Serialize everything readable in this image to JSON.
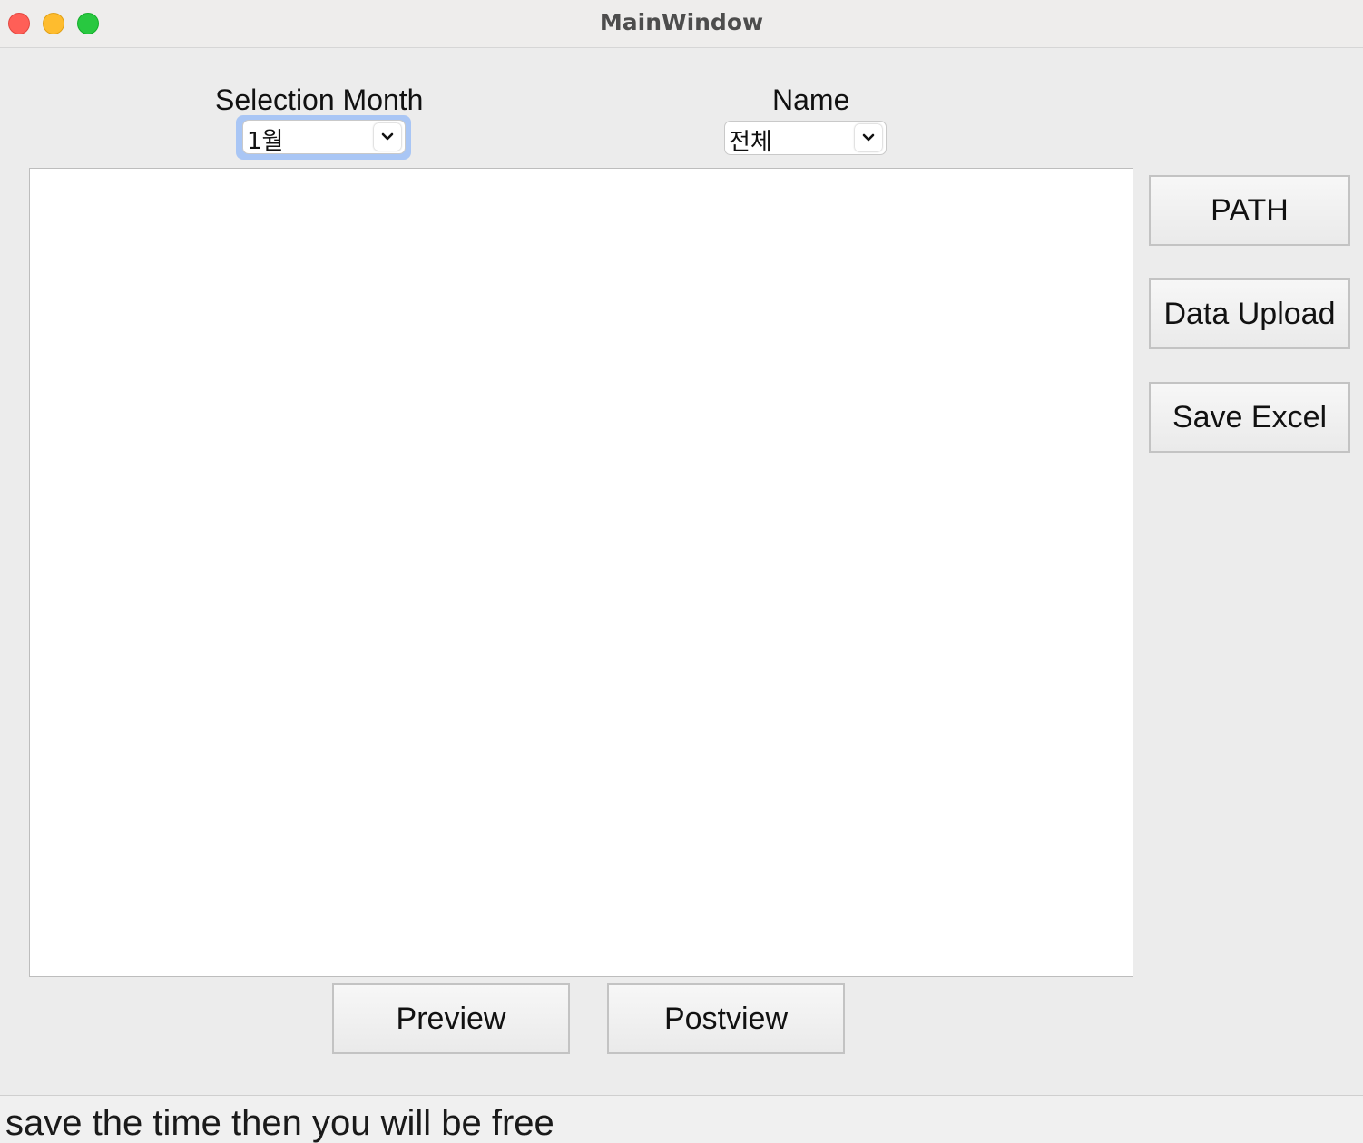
{
  "window": {
    "title": "MainWindow"
  },
  "filters": {
    "month_label": "Selection Month",
    "month_value": "1월",
    "name_label": "Name",
    "name_value": "전체"
  },
  "side_buttons": {
    "path": "PATH",
    "data_upload": "Data Upload",
    "save_excel": "Save Excel"
  },
  "bottom_buttons": {
    "preview": "Preview",
    "postview": "Postview"
  },
  "status": {
    "message": "save the time then you will be free"
  },
  "colors": {
    "close": "#ff5f57",
    "minimize": "#febc2e",
    "maximize": "#28c840",
    "focus_ring": "#a9c6f5"
  },
  "icons": {
    "combo_arrow": "chevron-down-icon"
  }
}
